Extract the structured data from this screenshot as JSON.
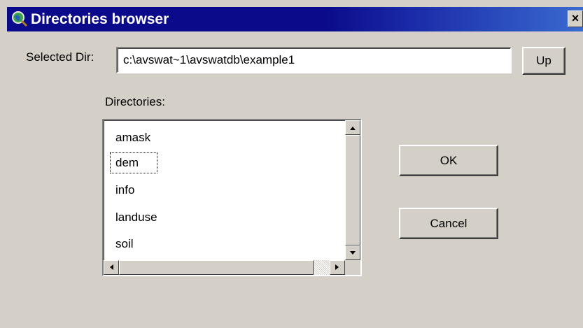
{
  "window": {
    "title": "Directories browser",
    "close_label": "×"
  },
  "selected_dir": {
    "label": "Selected Dir:",
    "value": "c:\\avswat~1\\avswatdb\\example1"
  },
  "buttons": {
    "up_label": "Up",
    "ok_label": "OK",
    "cancel_label": "Cancel"
  },
  "directories": {
    "label": "Directories:",
    "items": [
      "amask",
      "dem",
      "info",
      "landuse",
      "soil"
    ],
    "focused_item": "dem"
  },
  "icons": {
    "app": "magnifier-globe-icon",
    "scroll_up": "scroll-up-arrow-icon",
    "scroll_down": "scroll-down-arrow-icon",
    "scroll_left": "scroll-left-arrow-icon",
    "scroll_right": "scroll-right-arrow-icon"
  },
  "colors": {
    "titlebar": "#0a0a8a",
    "face": "#d4d0c8"
  }
}
